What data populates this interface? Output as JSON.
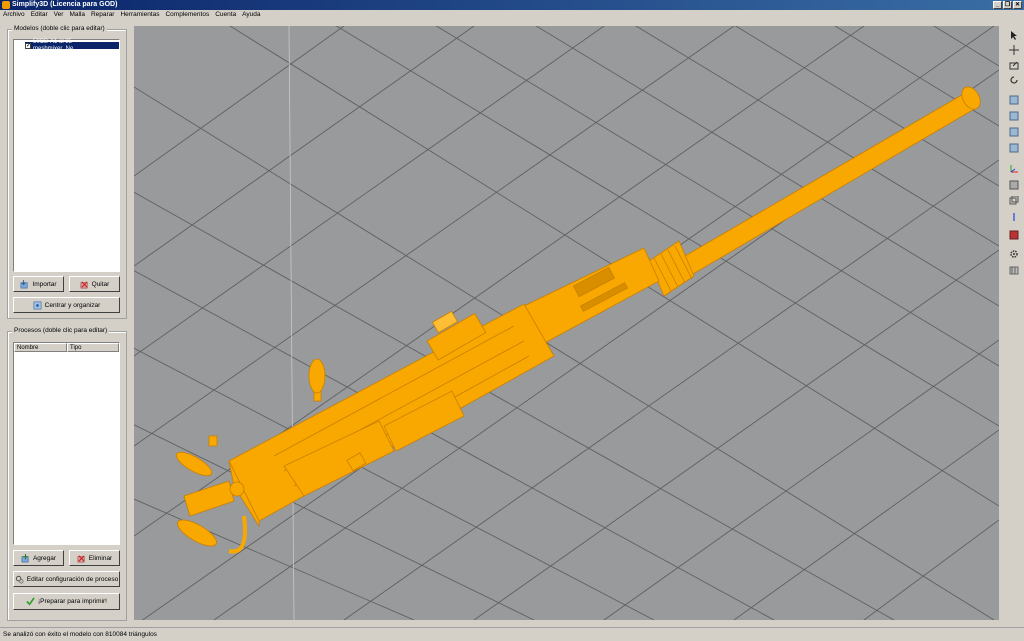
{
  "window": {
    "title": "Simplify3D (Licencia para GOD)",
    "controls": [
      "_",
      "❐",
      "✕"
    ]
  },
  "menu": [
    "Archivo",
    "Editar",
    "Ver",
    "Malla",
    "Reparar",
    "Herramientas",
    "Complementos",
    "Cuenta",
    "Ayuda"
  ],
  "models": {
    "group_label": "Modelos (doble clic para editar)",
    "items": [
      {
        "name": "50CB-A1 al 35 meshmixer_Ne...",
        "checked": true
      }
    ],
    "import_label": "Importar",
    "remove_label": "Quitar",
    "center_label": "Centrar y organizar"
  },
  "processes": {
    "group_label": "Procesos (doble clic para editar)",
    "columns": [
      "Nombre",
      "Tipo"
    ],
    "add_label": "Agregar",
    "delete_label": "Eliminar",
    "edit_label": "Editar configuración de proceso",
    "prepare_label": "¡Preparar para imprimir!"
  },
  "toolbar_icons": [
    "select-arrow-icon",
    "move-icon",
    "scale-icon",
    "rotate-icon",
    "view-default-icon",
    "view-front-icon",
    "view-top-icon",
    "view-side-icon",
    "axes-icon",
    "solid-view-icon",
    "wireframe-icon",
    "axis-z-icon",
    "cross-section-icon",
    "settings-gear-icon",
    "print-bed-icon"
  ],
  "colors": {
    "model": "#f8a800",
    "viewport_bg": "#999a9b",
    "titlebar": "#0a246a"
  },
  "status": "Se analizó con éxito el modelo con 810084 triángulos"
}
